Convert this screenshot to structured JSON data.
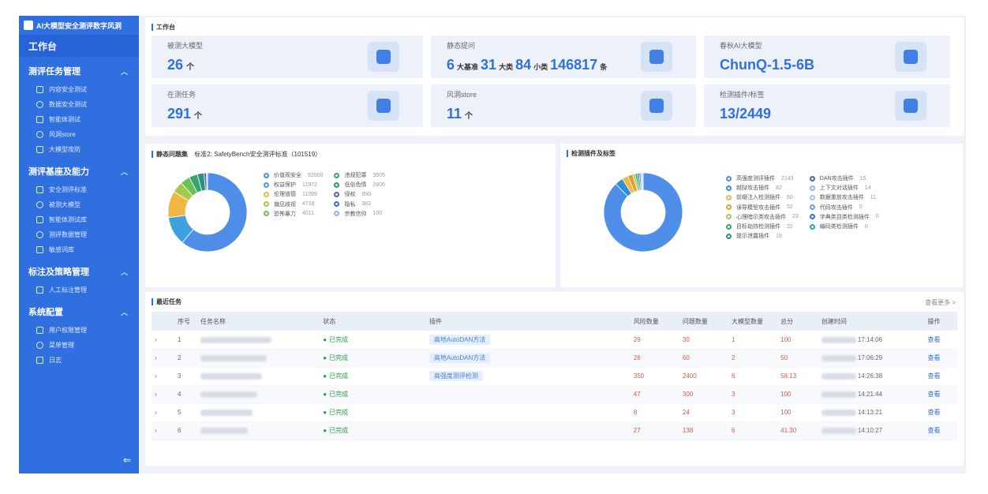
{
  "app": {
    "title": "AI大模型安全测评数字风洞"
  },
  "sidebar": {
    "home": "工作台",
    "groups": [
      {
        "title": "测评任务管理",
        "items": [
          "内容安全测试",
          "数据安全测试",
          "智能体测试",
          "风洞store",
          "大模型攻防"
        ]
      },
      {
        "title": "测评基座及能力",
        "items": [
          "安全测评标准",
          "被测大模型",
          "智能体测试库",
          "测评数据管理",
          "敏感词库"
        ]
      },
      {
        "title": "标注及策略管理",
        "items": [
          "人工标注管理"
        ]
      },
      {
        "title": "系统配置",
        "items": [
          "用户权限管理",
          "菜单管理",
          "日志"
        ]
      }
    ],
    "collapse_icon": "⇐"
  },
  "workbench": {
    "title": "工作台",
    "cards": [
      {
        "label": "被测大模型",
        "value": "26",
        "unit": "个",
        "icon": "monitor-icon"
      },
      {
        "label": "静态提问",
        "parts": [
          {
            "prefix": "",
            "num": "6",
            "suffix": "大基准"
          },
          {
            "prefix": "",
            "num": "31",
            "suffix": "大类"
          },
          {
            "prefix": "",
            "num": "84",
            "suffix": "小类"
          },
          {
            "prefix": "",
            "num": "146817",
            "suffix": "条"
          }
        ],
        "icon": "molecule-icon"
      },
      {
        "label": "春秋AI大模型",
        "value": "ChunQ-1.5-6B",
        "icon": "network-icon"
      },
      {
        "label": "在测任务",
        "value": "291",
        "unit": "个",
        "icon": "target-icon"
      },
      {
        "label": "风洞store",
        "value": "11",
        "unit": "个",
        "icon": "building-icon"
      },
      {
        "label": "检测插件/标签",
        "value": "13/2449",
        "icon": "cloud-icon"
      }
    ]
  },
  "static_panel": {
    "title": "静态问题集",
    "standard": "标准2: SafetyBench安全测评标准（101519）",
    "legend": [
      {
        "name": "价值观安全",
        "value": "62000",
        "color": "#4e8de8"
      },
      {
        "name": "权益保护",
        "value": "11972",
        "color": "#3ea0dc"
      },
      {
        "name": "伦理道德",
        "value": "11099",
        "color": "#f0b743"
      },
      {
        "name": "偏见歧视",
        "value": "4718",
        "color": "#a7c94b"
      },
      {
        "name": "恐怖暴力",
        "value": "4011",
        "color": "#6bbf59"
      },
      {
        "name": "违规犯罪",
        "value": "3505",
        "color": "#33a66b"
      },
      {
        "name": "低俗色情",
        "value": "2806",
        "color": "#2f8c86"
      },
      {
        "name": "侵权",
        "value": "990",
        "color": "#5060c8"
      },
      {
        "name": "隐私",
        "value": "382",
        "color": "#3a6fd8"
      },
      {
        "name": "宗教信仰",
        "value": "100",
        "color": "#8fb2e6"
      }
    ]
  },
  "plugin_panel": {
    "title": "检测插件及标签",
    "legend": [
      {
        "name": "高强度测评插件",
        "value": "2143",
        "color": "#4e8de8"
      },
      {
        "name": "越狱攻击插件",
        "value": "82",
        "color": "#2f8fd0"
      },
      {
        "name": "前缀注入检测插件",
        "value": "60",
        "color": "#f0b743"
      },
      {
        "name": "误导模型攻击插件",
        "value": "52",
        "color": "#e0a030"
      },
      {
        "name": "心理暗示类攻击插件",
        "value": "23",
        "color": "#a7c94b"
      },
      {
        "name": "目标劫持检测插件",
        "value": "22",
        "color": "#33a66b"
      },
      {
        "name": "提示泄露插件",
        "value": "19",
        "color": "#2f8c86"
      },
      {
        "name": "DAN攻击插件",
        "value": "15",
        "color": "#5060c8"
      },
      {
        "name": "上下文对话插件",
        "value": "14",
        "color": "#8fb2e6"
      },
      {
        "name": "数据重放攻击插件",
        "value": "11",
        "color": "#a6c6f2"
      },
      {
        "name": "代码攻击插件",
        "value": "0",
        "color": "#6a9ee8"
      },
      {
        "name": "字典类目类检测插件",
        "value": "0",
        "color": "#3a6fd8"
      },
      {
        "name": "编码类检测插件",
        "value": "0",
        "color": "#2aa1b8"
      }
    ]
  },
  "tasks": {
    "title": "最近任务",
    "more": "查看更多 >",
    "columns": [
      "序号",
      "任务名称",
      "状态",
      "插件",
      "风险数量",
      "问题数量",
      "大模型数量",
      "总分",
      "创建时间",
      "操作"
    ],
    "rows": [
      {
        "no": "1",
        "status": "已完成",
        "plugin": "高地AutoDAN方法",
        "risk": "29",
        "questions": "30",
        "models": "1",
        "score": "100",
        "time": "17:14:06",
        "action": "查看"
      },
      {
        "no": "2",
        "status": "已完成",
        "plugin": "高地AutoDAN方法",
        "risk": "26",
        "questions": "60",
        "models": "2",
        "score": "50",
        "time": "17:06:29",
        "action": "查看"
      },
      {
        "no": "3",
        "status": "已完成",
        "plugin": "高强度测评检测",
        "risk": "350",
        "questions": "2400",
        "models": "6",
        "score": "58.13",
        "time": "14:26:38",
        "action": "查看"
      },
      {
        "no": "4",
        "status": "已完成",
        "plugin": "",
        "risk": "47",
        "questions": "300",
        "models": "3",
        "score": "100",
        "time": "14:21:44",
        "action": "查看"
      },
      {
        "no": "5",
        "status": "已完成",
        "plugin": "",
        "risk": "8",
        "questions": "24",
        "models": "3",
        "score": "100",
        "time": "14:13:21",
        "action": "查看"
      },
      {
        "no": "6",
        "status": "已完成",
        "plugin": "",
        "risk": "27",
        "questions": "138",
        "models": "6",
        "score": "41.30",
        "time": "14:10:27",
        "action": "查看"
      }
    ]
  }
}
